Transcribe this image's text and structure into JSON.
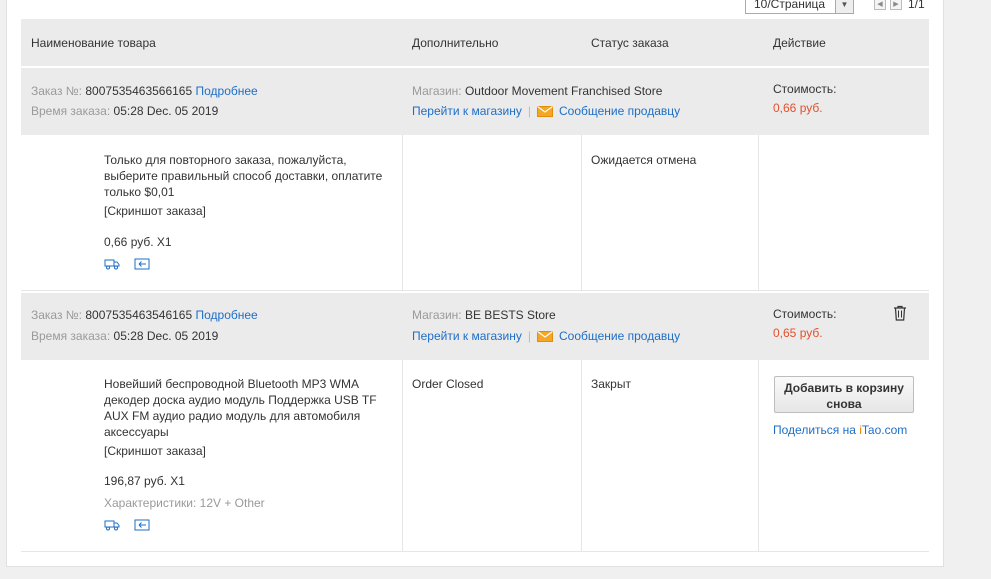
{
  "pager": {
    "per_page": "10/Страница",
    "count": "1/1"
  },
  "table_header": {
    "product": "Наименование товара",
    "extra": "Дополнительно",
    "status": "Статус заказа",
    "action": "Действие"
  },
  "orders": [
    {
      "order_label": "Заказ №:",
      "order_number": "8007535463566165",
      "details_link": "Подробнее",
      "time_label": "Время заказа:",
      "time": "05:28 Dec. 05 2019",
      "store_label": "Магазин:",
      "store_name": "Outdoor Movement Franchised Store",
      "go_to_store": "Перейти к магазину",
      "separator": "|",
      "message_seller": "Сообщение продавцу",
      "cost_label": "Стоимость:",
      "cost": "0,66 руб.",
      "product_lines": [
        "Только для повторного заказа, пожалуйста,",
        "выберите правильный способ доставки, оплатите",
        "только $0,01"
      ],
      "screenshot": "[Скриншот заказа]",
      "qty_price": "0,66 руб. X1",
      "status": "Ожидается отмена"
    },
    {
      "order_label": "Заказ №:",
      "order_number": "8007535463546165",
      "details_link": "Подробнее",
      "time_label": "Время заказа:",
      "time": "05:28 Dec. 05 2019",
      "store_label": "Магазин:",
      "store_name": "BE BESTS Store",
      "go_to_store": "Перейти к магазину",
      "separator": "|",
      "message_seller": "Сообщение продавцу",
      "cost_label": "Стоимость:",
      "cost": "0,65 руб.",
      "product_lines": [
        "Новейший беспроводной Bluetooth MP3 WMA",
        "декодер доска аудио модуль Поддержка USB TF",
        "AUX FM аудио радио модуль для автомобиля",
        "аксессуары"
      ],
      "screenshot": "[Скриншот заказа]",
      "qty_price": "196,87 руб. X1",
      "specs": "Характеристики: 12V + Other",
      "extra": "Order Closed",
      "status": "Закрыт",
      "add_to_cart": "Добавить в корзину снова",
      "share_text": "Поделиться на",
      "share_brand_i": "i",
      "share_brand_rest": "Tao.com"
    }
  ],
  "icons": [
    "truck-icon",
    "return-icon",
    "mail-icon",
    "trash-icon"
  ],
  "colors": {
    "link": "#1e6ec6",
    "price": "#e4502c",
    "header_bg": "#ebebeb",
    "mail": "#f5a623"
  }
}
